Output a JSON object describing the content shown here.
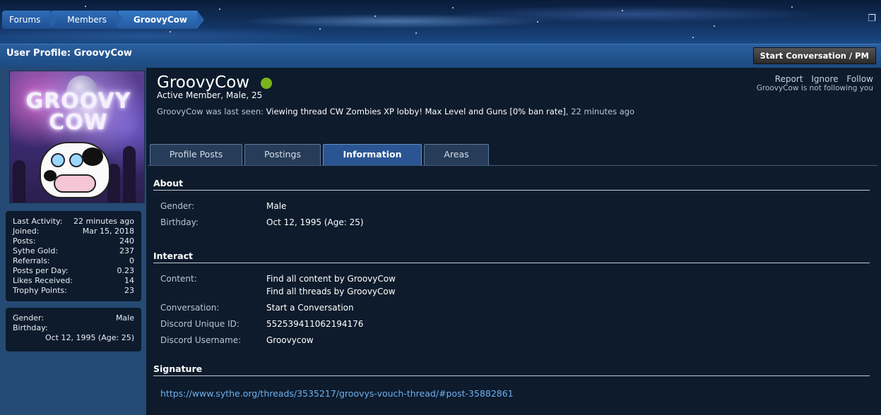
{
  "breadcrumb": {
    "items": [
      "Forums",
      "Members",
      "GroovyCow"
    ]
  },
  "page": {
    "title": "User Profile: GroovyCow",
    "start_conversation_label": "Start Conversation / PM"
  },
  "avatar": {
    "logo_text_line1": "GROOVY",
    "logo_text_line2": "COW"
  },
  "sidebar": {
    "stats": [
      {
        "label": "Last Activity:",
        "value": "22 minutes ago"
      },
      {
        "label": "Joined:",
        "value": "Mar 15, 2018"
      },
      {
        "label": "Posts:",
        "value": "240"
      },
      {
        "label": "Sythe Gold:",
        "value": "237"
      },
      {
        "label": "Referrals:",
        "value": "0"
      },
      {
        "label": "Posts per Day:",
        "value": "0.23"
      },
      {
        "label": "Likes Received:",
        "value": "14"
      },
      {
        "label": "Trophy Points:",
        "value": "23"
      }
    ],
    "info": {
      "gender_label": "Gender:",
      "gender_value": "Male",
      "birthday_label": "Birthday:",
      "birthday_value": "Oct 12, 1995 (Age: 25)"
    }
  },
  "profile": {
    "username": "GroovyCow",
    "user_title": "Active Member, Male, 25",
    "last_seen_prefix": "GroovyCow was last seen:",
    "last_seen_action": "Viewing thread",
    "last_seen_thread": "CW Zombies XP lobby! Max Level and Guns [0% ban rate]",
    "last_seen_time": ", 22 minutes ago",
    "actions": [
      "Report",
      "Ignore",
      "Follow"
    ],
    "follow_note": "GroovyCow is not following you",
    "online_color": "#7ab51d"
  },
  "tabs": [
    {
      "label": "Profile Posts",
      "active": false
    },
    {
      "label": "Postings",
      "active": false
    },
    {
      "label": "Information",
      "active": true
    },
    {
      "label": "Areas",
      "active": false
    }
  ],
  "information": {
    "about": {
      "heading": "About",
      "gender_label": "Gender:",
      "gender_value": "Male",
      "birthday_label": "Birthday:",
      "birthday_value": "Oct 12, 1995 (Age: 25)"
    },
    "interact": {
      "heading": "Interact",
      "content_label": "Content:",
      "content_link1": "Find all content by GroovyCow",
      "content_link2": "Find all threads by GroovyCow",
      "conversation_label": "Conversation:",
      "conversation_link": "Start a Conversation",
      "discord_id_label": "Discord Unique ID:",
      "discord_id_value": "552539411062194176",
      "discord_user_label": "Discord Username:",
      "discord_user_value": "Groovycow"
    },
    "signature": {
      "heading": "Signature",
      "link": "https://www.sythe.org/threads/3535217/groovys-vouch-thread/#post-35882861"
    }
  }
}
